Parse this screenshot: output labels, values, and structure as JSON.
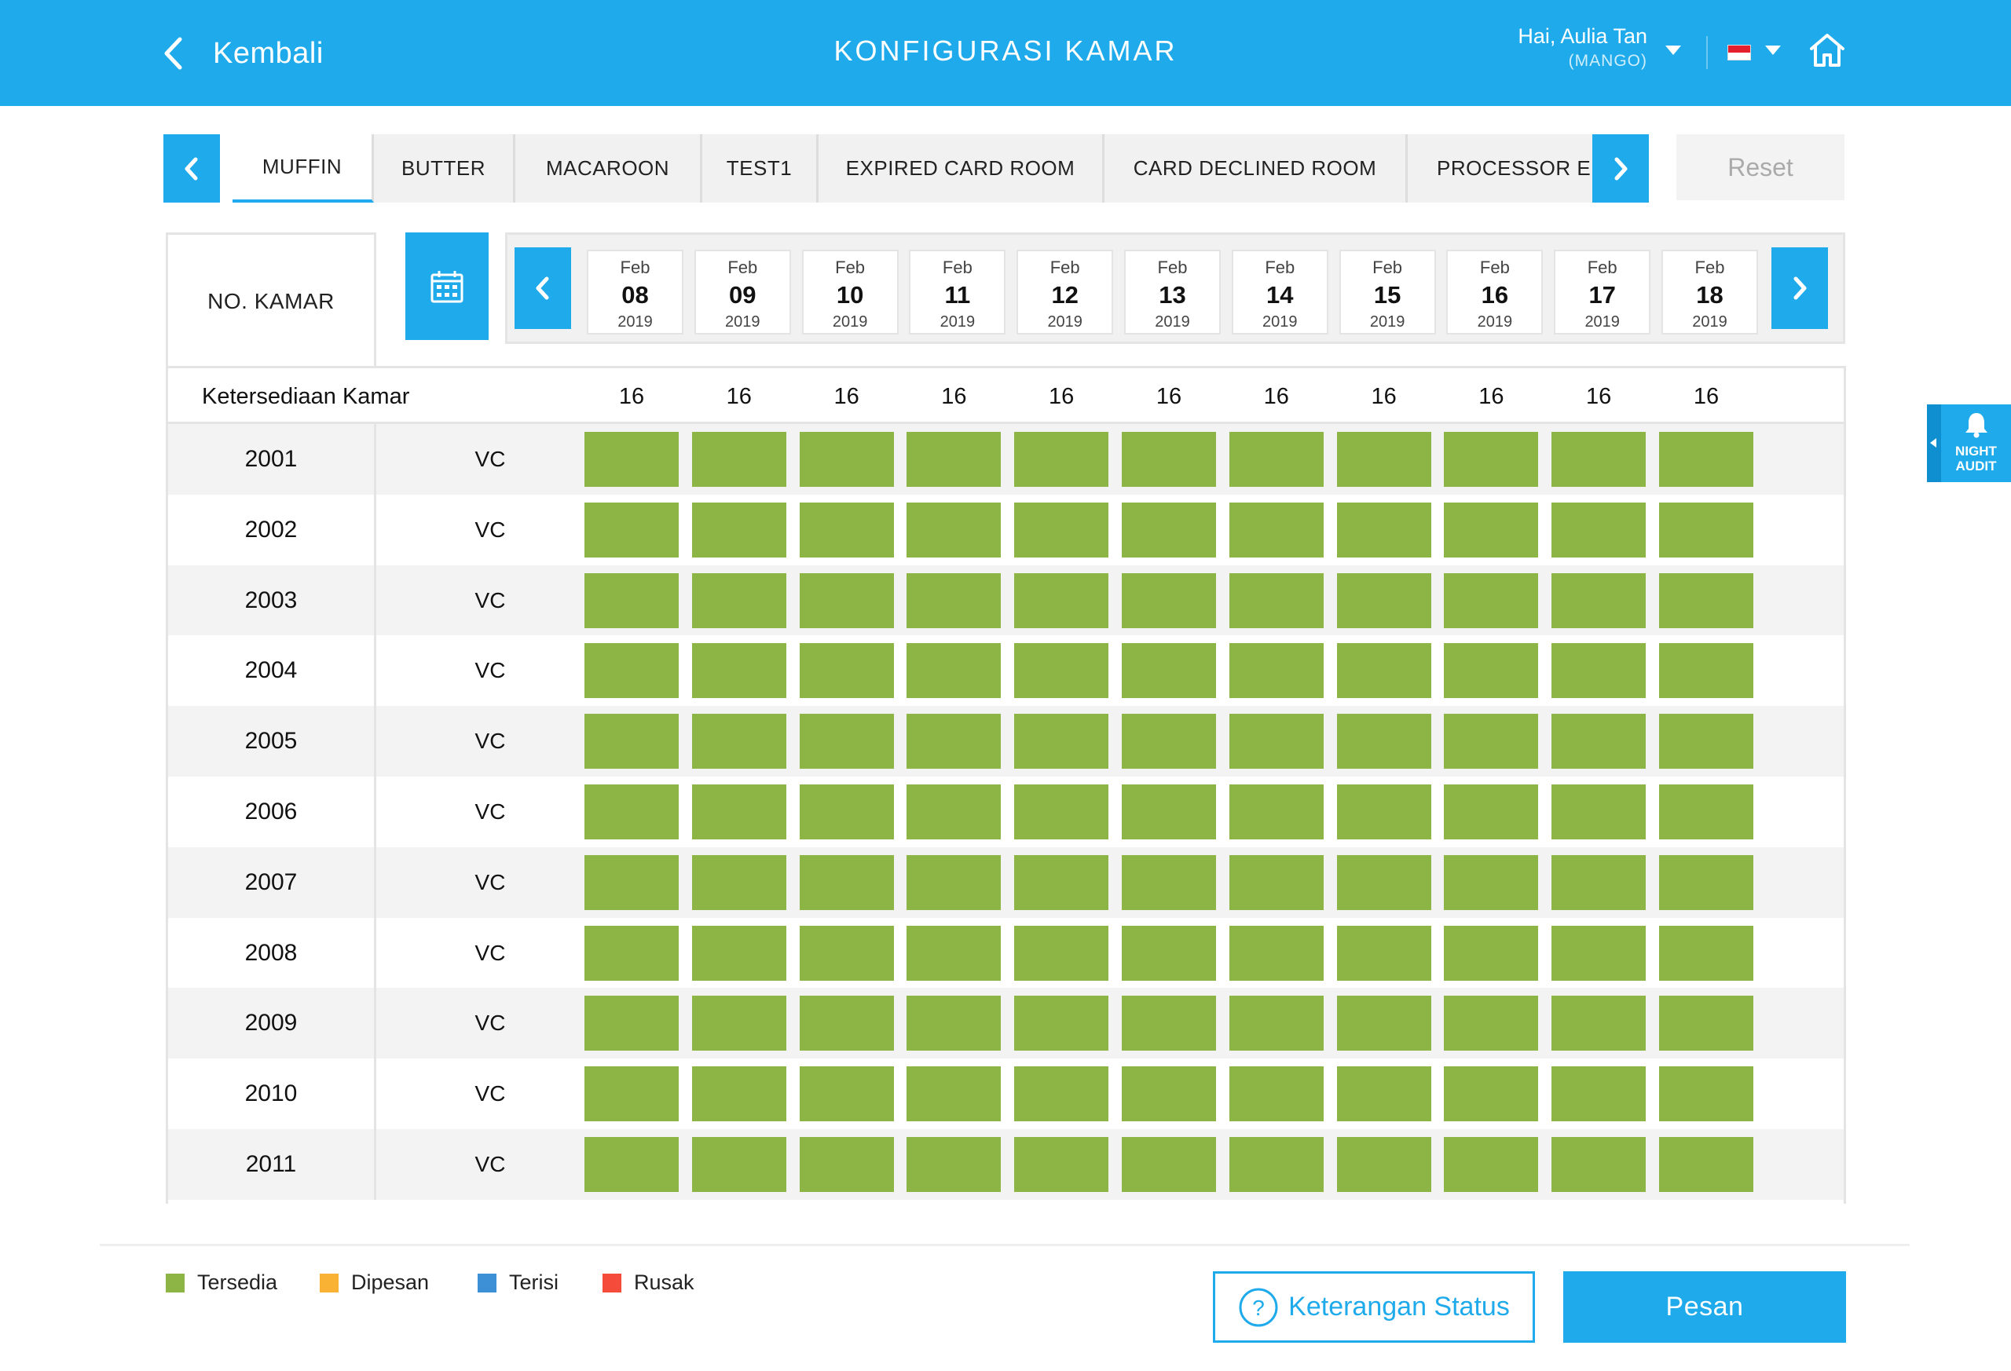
{
  "header": {
    "back_label": "Kembali",
    "title": "KONFIGURASI KAMAR",
    "greeting": "Hai, Aulia Tan",
    "property": "(MANGO)",
    "language_flag": "id-flag",
    "bg_color": "#1eaaeb"
  },
  "tabs": {
    "items": [
      {
        "label": "MUFFIN",
        "active": true
      },
      {
        "label": "BUTTER",
        "active": false
      },
      {
        "label": "MACAROON",
        "active": false
      },
      {
        "label": "TEST1",
        "active": false
      },
      {
        "label": "EXPIRED CARD ROOM",
        "active": false
      },
      {
        "label": "CARD DECLINED ROOM",
        "active": false
      },
      {
        "label": "PROCESSOR ERROR",
        "active": false
      }
    ],
    "reset_label": "Reset"
  },
  "dates": {
    "column_header": "NO. KAMAR",
    "items": [
      {
        "month": "Feb",
        "day": "08",
        "year": "2019"
      },
      {
        "month": "Feb",
        "day": "09",
        "year": "2019"
      },
      {
        "month": "Feb",
        "day": "10",
        "year": "2019"
      },
      {
        "month": "Feb",
        "day": "11",
        "year": "2019"
      },
      {
        "month": "Feb",
        "day": "12",
        "year": "2019"
      },
      {
        "month": "Feb",
        "day": "13",
        "year": "2019"
      },
      {
        "month": "Feb",
        "day": "14",
        "year": "2019"
      },
      {
        "month": "Feb",
        "day": "15",
        "year": "2019"
      },
      {
        "month": "Feb",
        "day": "16",
        "year": "2019"
      },
      {
        "month": "Feb",
        "day": "17",
        "year": "2019"
      },
      {
        "month": "Feb",
        "day": "18",
        "year": "2019"
      }
    ]
  },
  "availability": {
    "label": "Ketersediaan Kamar",
    "values": [
      "16",
      "16",
      "16",
      "16",
      "16",
      "16",
      "16",
      "16",
      "16",
      "16",
      "16"
    ]
  },
  "rooms": [
    {
      "number": "2001",
      "status": "VC",
      "cells": [
        "Tersedia",
        "Tersedia",
        "Tersedia",
        "Tersedia",
        "Tersedia",
        "Tersedia",
        "Tersedia",
        "Tersedia",
        "Tersedia",
        "Tersedia",
        "Tersedia"
      ]
    },
    {
      "number": "2002",
      "status": "VC",
      "cells": [
        "Tersedia",
        "Tersedia",
        "Tersedia",
        "Tersedia",
        "Tersedia",
        "Tersedia",
        "Tersedia",
        "Tersedia",
        "Tersedia",
        "Tersedia",
        "Tersedia"
      ]
    },
    {
      "number": "2003",
      "status": "VC",
      "cells": [
        "Tersedia",
        "Tersedia",
        "Tersedia",
        "Tersedia",
        "Tersedia",
        "Tersedia",
        "Tersedia",
        "Tersedia",
        "Tersedia",
        "Tersedia",
        "Tersedia"
      ]
    },
    {
      "number": "2004",
      "status": "VC",
      "cells": [
        "Tersedia",
        "Tersedia",
        "Tersedia",
        "Tersedia",
        "Tersedia",
        "Tersedia",
        "Tersedia",
        "Tersedia",
        "Tersedia",
        "Tersedia",
        "Tersedia"
      ]
    },
    {
      "number": "2005",
      "status": "VC",
      "cells": [
        "Tersedia",
        "Tersedia",
        "Tersedia",
        "Tersedia",
        "Tersedia",
        "Tersedia",
        "Tersedia",
        "Tersedia",
        "Tersedia",
        "Tersedia",
        "Tersedia"
      ]
    },
    {
      "number": "2006",
      "status": "VC",
      "cells": [
        "Tersedia",
        "Tersedia",
        "Tersedia",
        "Tersedia",
        "Tersedia",
        "Tersedia",
        "Tersedia",
        "Tersedia",
        "Tersedia",
        "Tersedia",
        "Tersedia"
      ]
    },
    {
      "number": "2007",
      "status": "VC",
      "cells": [
        "Tersedia",
        "Tersedia",
        "Tersedia",
        "Tersedia",
        "Tersedia",
        "Tersedia",
        "Tersedia",
        "Tersedia",
        "Tersedia",
        "Tersedia",
        "Tersedia"
      ]
    },
    {
      "number": "2008",
      "status": "VC",
      "cells": [
        "Tersedia",
        "Tersedia",
        "Tersedia",
        "Tersedia",
        "Tersedia",
        "Tersedia",
        "Tersedia",
        "Tersedia",
        "Tersedia",
        "Tersedia",
        "Tersedia"
      ]
    },
    {
      "number": "2009",
      "status": "VC",
      "cells": [
        "Tersedia",
        "Tersedia",
        "Tersedia",
        "Tersedia",
        "Tersedia",
        "Tersedia",
        "Tersedia",
        "Tersedia",
        "Tersedia",
        "Tersedia",
        "Tersedia"
      ]
    },
    {
      "number": "2010",
      "status": "VC",
      "cells": [
        "Tersedia",
        "Tersedia",
        "Tersedia",
        "Tersedia",
        "Tersedia",
        "Tersedia",
        "Tersedia",
        "Tersedia",
        "Tersedia",
        "Tersedia",
        "Tersedia"
      ]
    },
    {
      "number": "2011",
      "status": "VC",
      "cells": [
        "Tersedia",
        "Tersedia",
        "Tersedia",
        "Tersedia",
        "Tersedia",
        "Tersedia",
        "Tersedia",
        "Tersedia",
        "Tersedia",
        "Tersedia",
        "Tersedia"
      ]
    }
  ],
  "legend": [
    {
      "label": "Tersedia",
      "color": "#8db545"
    },
    {
      "label": "Dipesan",
      "color": "#f9b233"
    },
    {
      "label": "Terisi",
      "color": "#3d8fd6"
    },
    {
      "label": "Rusak",
      "color": "#f44b3a"
    }
  ],
  "footer": {
    "status_info_label": "Keterangan Status",
    "book_label": "Pesan"
  },
  "night_audit": {
    "line1": "NIGHT",
    "line2": "AUDIT"
  }
}
